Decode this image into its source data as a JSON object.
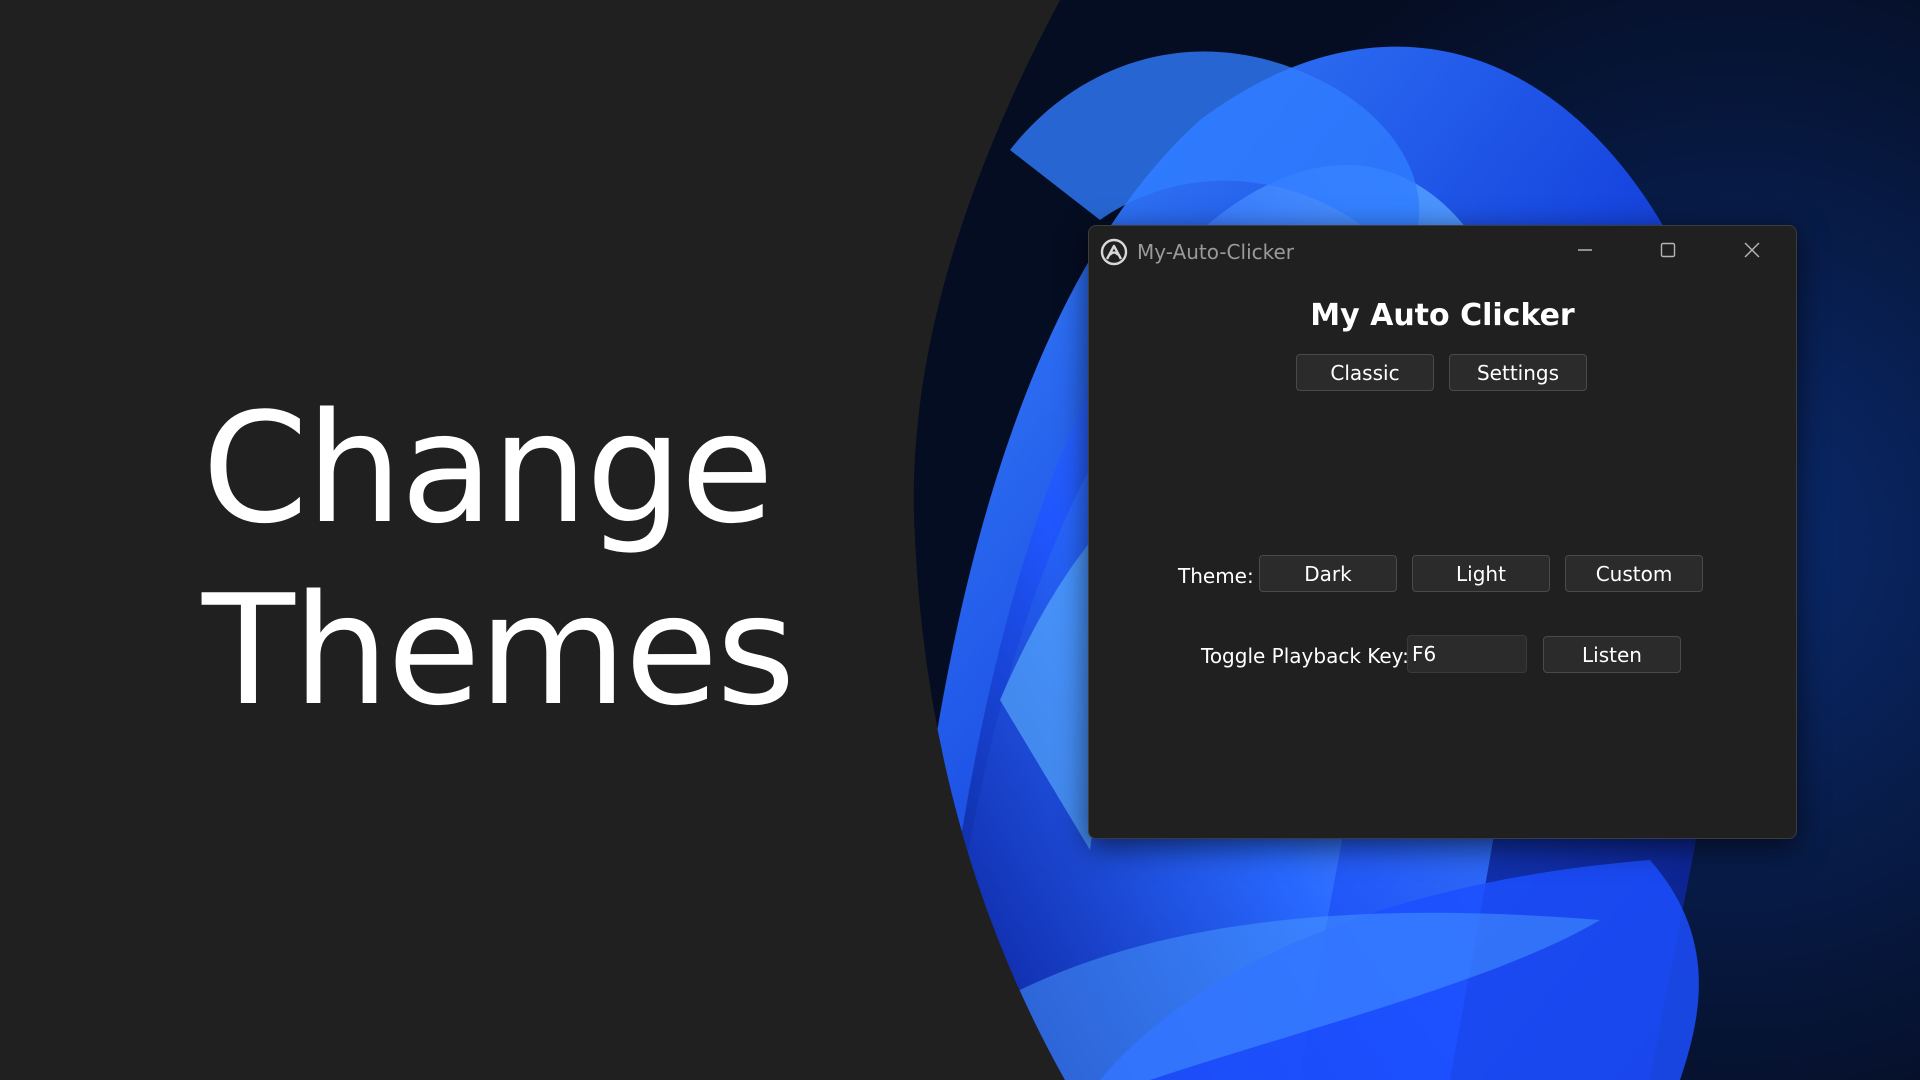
{
  "headline": {
    "line1": "Change",
    "line2": "Themes"
  },
  "window": {
    "title": "My-Auto-Clicker",
    "app_icon": "app-logo-icon",
    "controls": {
      "minimize": "minimize-icon",
      "maximize": "maximize-icon",
      "close": "close-icon"
    }
  },
  "app": {
    "heading": "My Auto Clicker",
    "nav": {
      "classic_label": "Classic",
      "settings_label": "Settings"
    },
    "theme": {
      "label": "Theme:",
      "dark_label": "Dark",
      "light_label": "Light",
      "custom_label": "Custom"
    },
    "playback": {
      "label": "Toggle Playback Key:",
      "key_value": "F6",
      "listen_label": "Listen"
    }
  },
  "colors": {
    "background": "#202020",
    "window_bg": "#202020",
    "button_bg": "#2b2b2b",
    "wallpaper_accent": "#1a4cff"
  }
}
